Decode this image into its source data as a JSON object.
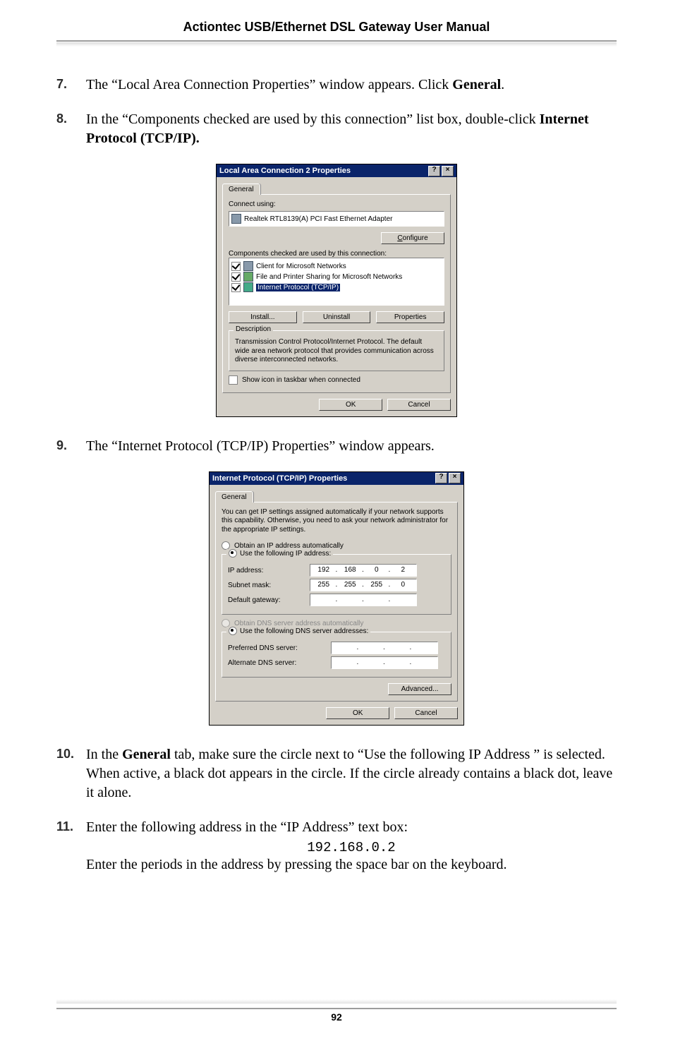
{
  "header": {
    "title": "Actiontec USB/Ethernet DSL Gateway User Manual"
  },
  "steps": {
    "s7": {
      "num": "7.",
      "a": "The “Local Area Connection Properties” window appears. Click ",
      "b": "General",
      "c": "."
    },
    "s8": {
      "num": "8.",
      "a": "In the “Components checked are used by this connection” list box, double-click ",
      "b": "Internet Protocol (",
      "sc": "TCP/IP",
      "c": ")."
    },
    "s9": {
      "num": "9.",
      "a": "The “Internet Protocol (",
      "sc": "TCP/IP",
      "b": ") Properties” window appears."
    },
    "s10": {
      "num": "10.",
      "a": "In the ",
      "b": "General",
      "c": " tab, make sure the circle next to “Use the following ",
      "sc": "IP",
      "d": " Address ” is selected. When active, a black dot appears in the circle. If the circle already contains a black dot, leave it alone."
    },
    "s11": {
      "num": "11.",
      "a": "Enter the following address in the “",
      "sc": "IP",
      "b": " Address” text box:",
      "code": "192.168.0.2",
      "c": "Enter the periods in the address by pressing the space bar on the keyboard."
    }
  },
  "lac": {
    "title": "Local Area Connection 2 Properties",
    "tab": "General",
    "connect_using": "Connect using:",
    "adapter": "Realtek RTL8139(A) PCI Fast Ethernet Adapter",
    "configure": "Configure",
    "components_label": "Components checked are used by this connection:",
    "items": [
      "Client for Microsoft Networks",
      "File and Printer Sharing for Microsoft Networks",
      "Internet Protocol (TCP/IP)"
    ],
    "install": "Install...",
    "uninstall": "Uninstall",
    "properties": "Properties",
    "description_title": "Description",
    "description_text": "Transmission Control Protocol/Internet Protocol. The default wide area network protocol that provides communication across diverse interconnected networks.",
    "show_icon": "Show icon in taskbar when connected",
    "ok": "OK",
    "cancel": "Cancel"
  },
  "tcp": {
    "title": "Internet Protocol (TCP/IP) Properties",
    "tab": "General",
    "blurb": "You can get IP settings assigned automatically if your network supports this capability. Otherwise, you need to ask your network administrator for the appropriate IP settings.",
    "obtain_ip": "Obtain an IP address automatically",
    "use_ip": "Use the following IP address:",
    "ip_label": "IP address:",
    "ip": [
      "192",
      "168",
      "0",
      "2"
    ],
    "subnet_label": "Subnet mask:",
    "subnet": [
      "255",
      "255",
      "255",
      "0"
    ],
    "gateway_label": "Default gateway:",
    "gateway": [
      "",
      "",
      "",
      ""
    ],
    "obtain_dns": "Obtain DNS server address automatically",
    "use_dns": "Use the following DNS server addresses:",
    "pref_dns_label": "Preferred DNS server:",
    "pref_dns": [
      "",
      "",
      "",
      ""
    ],
    "alt_dns_label": "Alternate DNS server:",
    "alt_dns": [
      "",
      "",
      "",
      ""
    ],
    "advanced": "Advanced...",
    "ok": "OK",
    "cancel": "Cancel"
  },
  "footer": {
    "page": "92"
  }
}
